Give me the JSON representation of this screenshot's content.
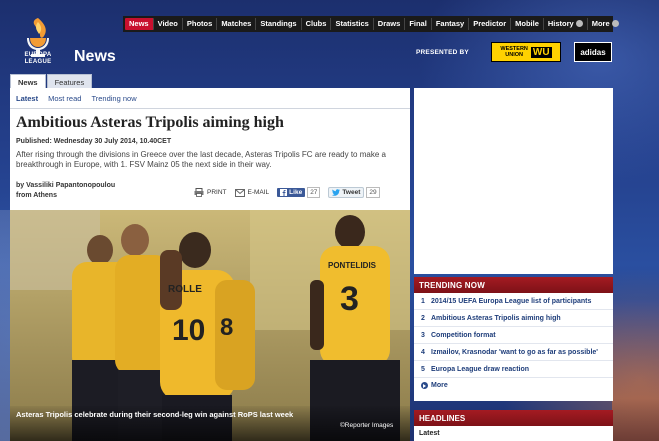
{
  "brand": {
    "logo_text": "EUROPA\nLEAGUE",
    "section_title": "News"
  },
  "topnav": [
    {
      "label": "News",
      "active": true
    },
    {
      "label": "Video"
    },
    {
      "label": "Photos"
    },
    {
      "label": "Matches"
    },
    {
      "label": "Standings"
    },
    {
      "label": "Clubs"
    },
    {
      "label": "Statistics"
    },
    {
      "label": "Draws"
    },
    {
      "label": "Final"
    },
    {
      "label": "Fantasy"
    },
    {
      "label": "Predictor"
    },
    {
      "label": "Mobile"
    },
    {
      "label": "History",
      "dropdown": true
    },
    {
      "label": "More",
      "dropdown": true
    }
  ],
  "sponsors": {
    "presented_by": "PRESENTED BY",
    "western_union_text": "WESTERN\nUNION",
    "western_union_mark": "WU",
    "adidas": "adidas"
  },
  "tabs": [
    {
      "label": "News",
      "active": true
    },
    {
      "label": "Features"
    }
  ],
  "subnav": [
    "Latest",
    "Most read",
    "Trending now"
  ],
  "article": {
    "headline": "Ambitious Asteras Tripolis aiming high",
    "published": "Published: Wednesday 30 July 2014, 10.40CET",
    "summary": "After rising through the divisions in Greece over the last decade, Asteras Tripolis FC are ready to make a breakthrough in Europe, with 1. FSV Mainz 05 the next side in their way.",
    "byline_author": "by Vassiliki Papantonopoulou",
    "byline_place": "from Athens",
    "tools": {
      "print": "PRINT",
      "email": "E-MAIL",
      "like": "Like",
      "like_count": "27",
      "tweet": "Tweet",
      "tweet_count": "29"
    },
    "photo": {
      "caption": "Asteras Tripolis celebrate during their second-leg win against RoPS last week",
      "credit": "©Reporter Images",
      "jersey_names": [
        "ROLLE",
        "PONTELIDIS"
      ],
      "jersey_numbers": [
        "10",
        "3",
        "8"
      ]
    }
  },
  "trending": {
    "title": "TRENDING NOW",
    "items": [
      {
        "num": "1",
        "text": "2014/15 UEFA Europa League list of participants"
      },
      {
        "num": "2",
        "text": "Ambitious Asteras Tripolis aiming high"
      },
      {
        "num": "3",
        "text": "Competition format"
      },
      {
        "num": "4",
        "text": "Izmailov, Krasnodar 'want to go as far as possible'"
      },
      {
        "num": "5",
        "text": "Europa League draw reaction"
      }
    ],
    "more": "More"
  },
  "headlines": {
    "title": "HEADLINES",
    "sub": "Latest"
  },
  "colors": {
    "accent_red": "#c8102e",
    "panel_red": "#8f151c",
    "link_blue": "#1e3d7a",
    "bg_blue": "#24408c",
    "wu_yellow": "#ffd200"
  }
}
